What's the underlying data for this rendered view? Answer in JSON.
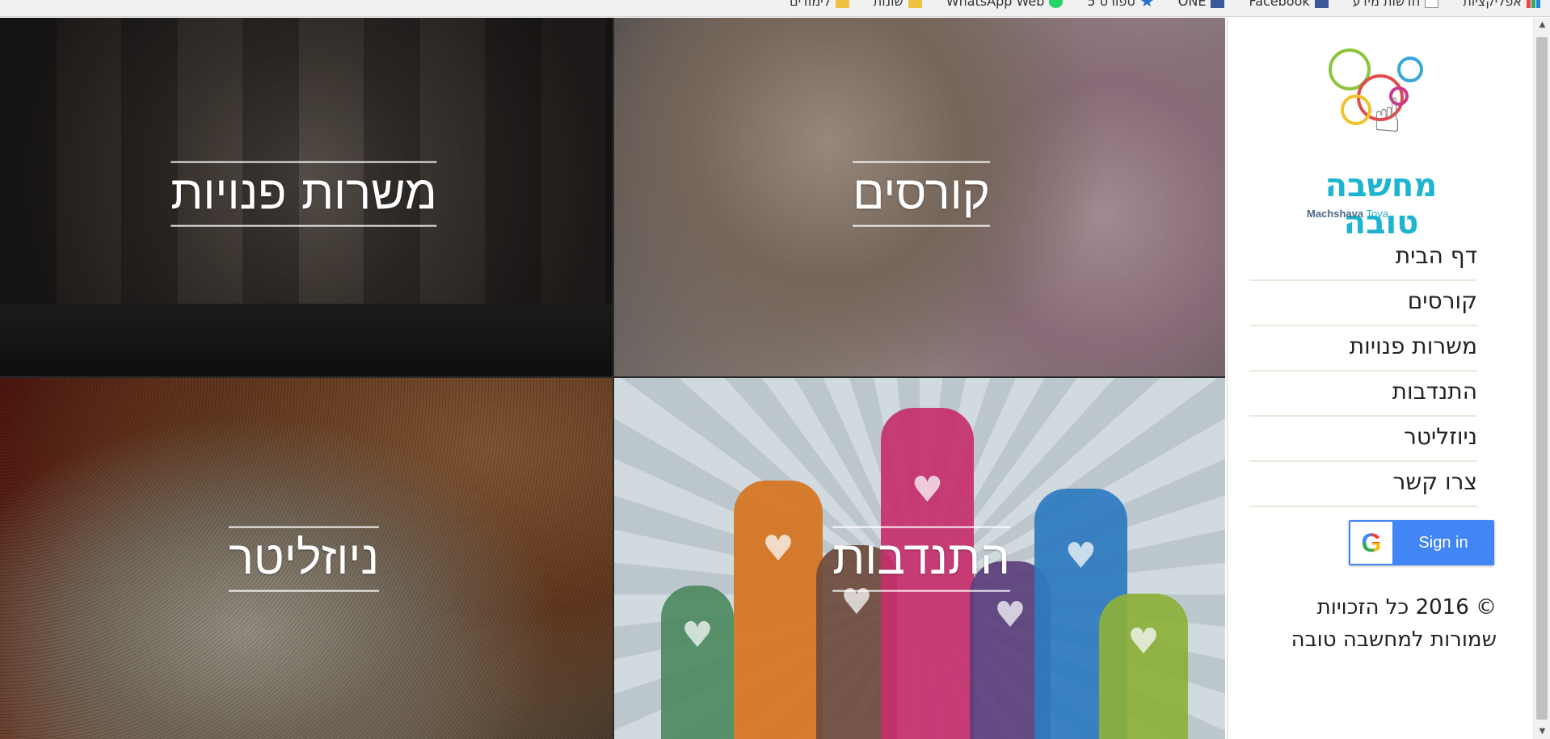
{
  "bookmarks": [
    {
      "label": "אפליקציות",
      "icon": "apps-grid-icon"
    },
    {
      "label": "חדשות מידע",
      "icon": "page-icon"
    },
    {
      "label": "Facebook",
      "icon": "facebook-icon"
    },
    {
      "label": "ONE",
      "icon": "facebook-icon"
    },
    {
      "label": "ספורט 5",
      "icon": "star-icon"
    },
    {
      "label": "WhatsApp Web",
      "icon": "whatsapp-icon"
    },
    {
      "label": "שונות",
      "icon": "folder-icon"
    },
    {
      "label": "לימודים",
      "icon": "folder-icon"
    }
  ],
  "tiles": {
    "jobs": "משרות פנויות",
    "courses": "קורסים",
    "newsletter": "ניוזליטר",
    "volunteering": "התנדבות"
  },
  "logo": {
    "name": "מחשבה טובה",
    "sub_main": "Machshava",
    "sub_accent": "Tova_"
  },
  "menu": [
    "דף הבית",
    "קורסים",
    "משרות פנויות",
    "התנדבות",
    "ניוזליטר",
    "צרו קשר"
  ],
  "signin": {
    "label": "Sign in",
    "icon_letter": "G"
  },
  "copyright": "© 2016 כל הזכויות שמורות למחשבה טובה",
  "scrollbar": {
    "up": "▲",
    "down": "▼"
  },
  "colors": {
    "brand": "#1db4cf",
    "google_blue": "#4285f4",
    "menu_divider": "#ece7da"
  }
}
